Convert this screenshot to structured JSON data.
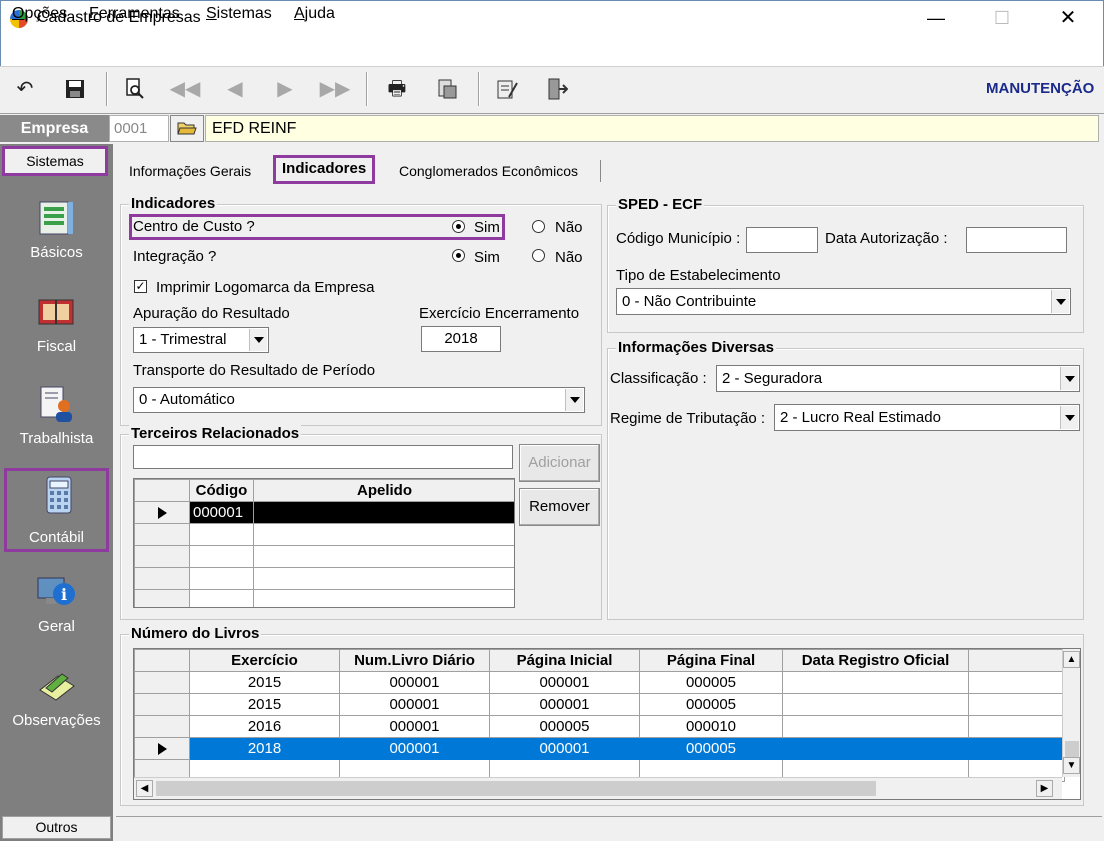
{
  "window": {
    "title": "Cadastro de Empresas",
    "min": "—",
    "max": "☐",
    "close": "✕"
  },
  "menu": [
    {
      "label_u": "O",
      "label": "pções"
    },
    {
      "label_u": "F",
      "label": "erramentas"
    },
    {
      "label_u": "S",
      "label": "istemas"
    },
    {
      "label_u": "A",
      "label": "juda"
    }
  ],
  "toolbar": {
    "mode": "MANUTENÇÃO"
  },
  "empresa": {
    "label": "Empresa",
    "code": "0001",
    "name": "EFD REINF"
  },
  "sidebar": {
    "header": "Sistemas",
    "items": [
      "Básicos",
      "Fiscal",
      "Trabalhista",
      "Contábil",
      "Geral",
      "Observações"
    ],
    "footer": "Outros"
  },
  "tabs": [
    "Informações Gerais",
    "Indicadores",
    "Conglomerados Econômicos"
  ],
  "indicadores": {
    "title": "Indicadores",
    "centro_custo": "Centro de Custo ?",
    "integracao": "Integração ?",
    "sim": "Sim",
    "nao": "Não",
    "imprimir_logo": "Imprimir Logomarca da Empresa",
    "apuracao_label": "Apuração do Resultado",
    "apuracao_value": "1 - Trimestral",
    "exercicio_label": "Exercício Encerramento",
    "exercicio_value": "2018",
    "transporte_label": "Transporte do Resultado de Período",
    "transporte_value": "0 - Automático"
  },
  "terceiros": {
    "title": "Terceiros Relacionados",
    "btn_add": "Adicionar",
    "btn_remove": "Remover",
    "col_codigo": "Código",
    "col_apelido": "Apelido",
    "row1_codigo": "000001"
  },
  "sped": {
    "title": "SPED - ECF",
    "cod_municipio": "Código Município :",
    "data_autorizacao": "Data Autorização :",
    "tipo_label": "Tipo de Estabelecimento",
    "tipo_value": "0 - Não Contribuinte"
  },
  "diversas": {
    "title": "Informações Diversas",
    "classificacao_label": "Classificação :",
    "classificacao_value": "2 - Seguradora",
    "regime_label": "Regime de Tributação :",
    "regime_value": "2 - Lucro Real Estimado"
  },
  "livros": {
    "title": "Número do Livros",
    "headers": [
      "Exercício",
      "Num.Livro Diário",
      "Página Inicial",
      "Página Final",
      "Data Registro Oficial"
    ],
    "rows": [
      [
        "2015",
        "000001",
        "000001",
        "000005",
        ""
      ],
      [
        "2015",
        "000001",
        "000001",
        "000005",
        ""
      ],
      [
        "2016",
        "000001",
        "000005",
        "000010",
        ""
      ],
      [
        "2018",
        "000001",
        "000001",
        "000005",
        ""
      ]
    ]
  }
}
